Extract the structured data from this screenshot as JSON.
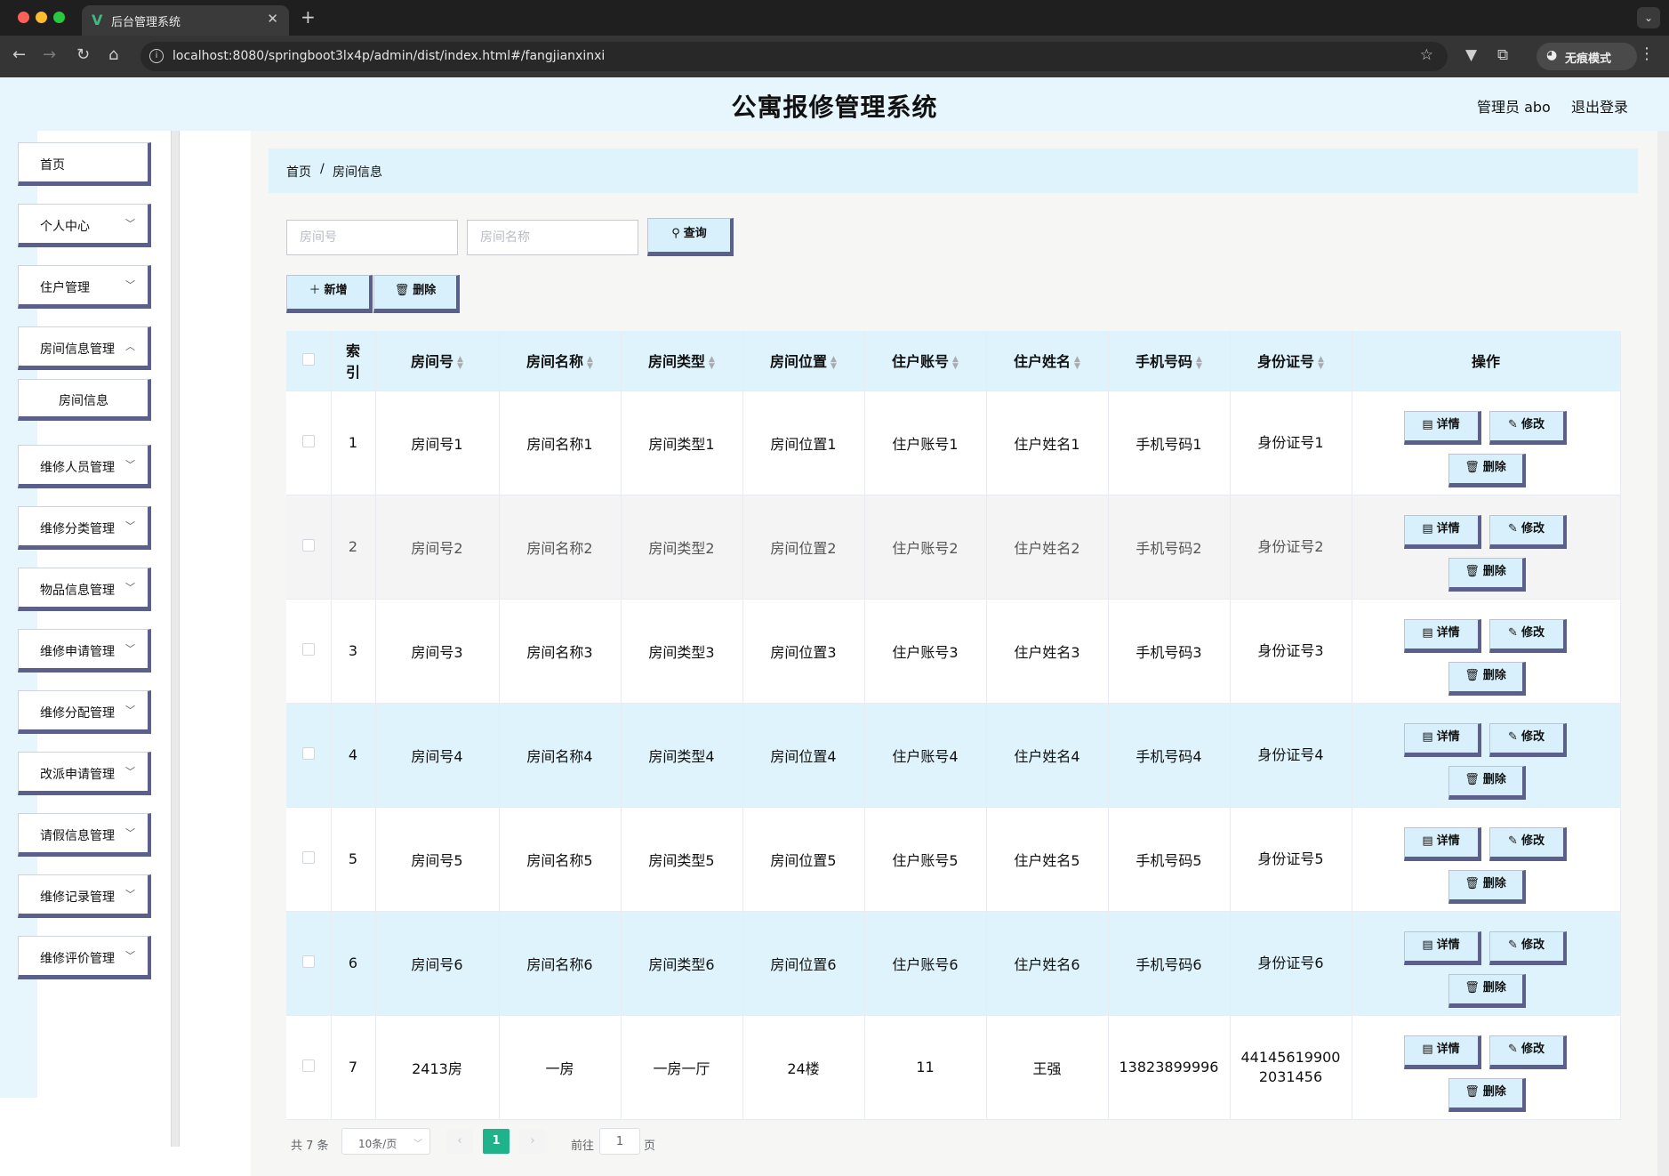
{
  "browser": {
    "tab_title": "后台管理系统",
    "tab_logo": "V",
    "url": "localhost:8080/springboot3lx4p/admin/dist/index.html#/fangjianxinxi",
    "incognito_label": "无痕模式"
  },
  "header": {
    "title": "公寓报修管理系统",
    "user": "管理员 abo",
    "logout": "退出登录"
  },
  "sidebar": {
    "items": [
      {
        "label": "首页"
      },
      {
        "label": "个人中心"
      },
      {
        "label": "住户管理"
      },
      {
        "label": "房间信息管理"
      },
      {
        "label": "房间信息"
      },
      {
        "label": "维修人员管理"
      },
      {
        "label": "维修分类管理"
      },
      {
        "label": "物品信息管理"
      },
      {
        "label": "维修申请管理"
      },
      {
        "label": "维修分配管理"
      },
      {
        "label": "改派申请管理"
      },
      {
        "label": "请假信息管理"
      },
      {
        "label": "维修记录管理"
      },
      {
        "label": "维修评价管理"
      }
    ]
  },
  "breadcrumb": {
    "home": "首页",
    "separator": "/",
    "current": "房间信息"
  },
  "search": {
    "room_no_placeholder": "房间号",
    "room_name_placeholder": "房间名称",
    "query_label": "查询"
  },
  "actions": {
    "add_label": "新增",
    "delete_label": "删除"
  },
  "table": {
    "headers": {
      "index": "索引",
      "room_no": "房间号",
      "room_name": "房间名称",
      "room_type": "房间类型",
      "room_location": "房间位置",
      "account": "住户账号",
      "resident_name": "住户姓名",
      "phone": "手机号码",
      "id_card": "身份证号",
      "ops": "操作"
    },
    "op_labels": {
      "detail": "详情",
      "edit": "修改",
      "delete": "删除"
    },
    "rows": [
      {
        "index": "1",
        "room_no": "房间号1",
        "room_name": "房间名称1",
        "room_type": "房间类型1",
        "room_location": "房间位置1",
        "account": "住户账号1",
        "resident_name": "住户姓名1",
        "phone": "手机号码1",
        "id_card": "身份证号1"
      },
      {
        "index": "2",
        "room_no": "房间号2",
        "room_name": "房间名称2",
        "room_type": "房间类型2",
        "room_location": "房间位置2",
        "account": "住户账号2",
        "resident_name": "住户姓名2",
        "phone": "手机号码2",
        "id_card": "身份证号2"
      },
      {
        "index": "3",
        "room_no": "房间号3",
        "room_name": "房间名称3",
        "room_type": "房间类型3",
        "room_location": "房间位置3",
        "account": "住户账号3",
        "resident_name": "住户姓名3",
        "phone": "手机号码3",
        "id_card": "身份证号3"
      },
      {
        "index": "4",
        "room_no": "房间号4",
        "room_name": "房间名称4",
        "room_type": "房间类型4",
        "room_location": "房间位置4",
        "account": "住户账号4",
        "resident_name": "住户姓名4",
        "phone": "手机号码4",
        "id_card": "身份证号4"
      },
      {
        "index": "5",
        "room_no": "房间号5",
        "room_name": "房间名称5",
        "room_type": "房间类型5",
        "room_location": "房间位置5",
        "account": "住户账号5",
        "resident_name": "住户姓名5",
        "phone": "手机号码5",
        "id_card": "身份证号5"
      },
      {
        "index": "6",
        "room_no": "房间号6",
        "room_name": "房间名称6",
        "room_type": "房间类型6",
        "room_location": "房间位置6",
        "account": "住户账号6",
        "resident_name": "住户姓名6",
        "phone": "手机号码6",
        "id_card": "身份证号6"
      },
      {
        "index": "7",
        "room_no": "2413房",
        "room_name": "一房",
        "room_type": "一房一厅",
        "room_location": "24楼",
        "account": "11",
        "resident_name": "王强",
        "phone": "13823899996",
        "id_card": "441456199002031456"
      }
    ]
  },
  "pagination": {
    "total": "共 7 条",
    "page_size": "10条/页",
    "current_page": "1",
    "goto_prefix": "前往",
    "goto_value": "1",
    "goto_suffix": "页"
  },
  "colors": {
    "header_bg": "#e6f6fc",
    "accent_blue": "#def3fb",
    "button_shadow": "#5b5f8c",
    "pager_active": "#20b28a"
  }
}
